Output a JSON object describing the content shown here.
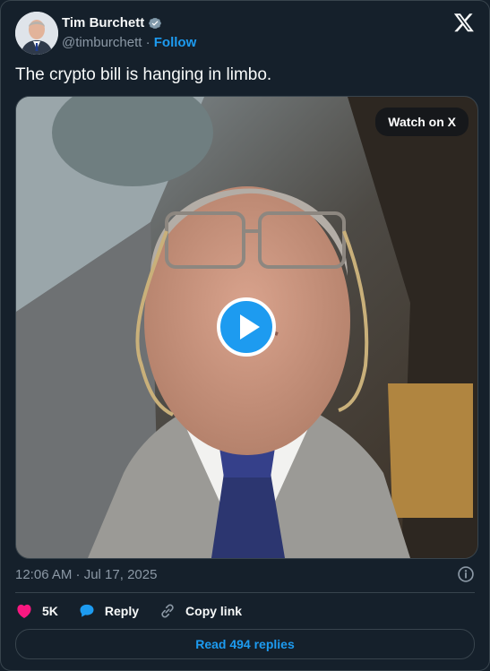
{
  "author": {
    "name": "Tim Burchett",
    "handle": "@timburchett",
    "separator": "·",
    "follow_label": "Follow"
  },
  "tweet": {
    "text": "The crypto bill is hanging in limbo.",
    "timestamp": "12:06 AM · Jul 17, 2025"
  },
  "media": {
    "watch_label": "Watch on X"
  },
  "actions": {
    "like_count": "5K",
    "reply_label": "Reply",
    "copy_label": "Copy link"
  },
  "replies_button": "Read 494 replies",
  "colors": {
    "background": "#15202b",
    "accent": "#1d9bf0",
    "like": "#f91880",
    "muted": "#8b98a5"
  }
}
